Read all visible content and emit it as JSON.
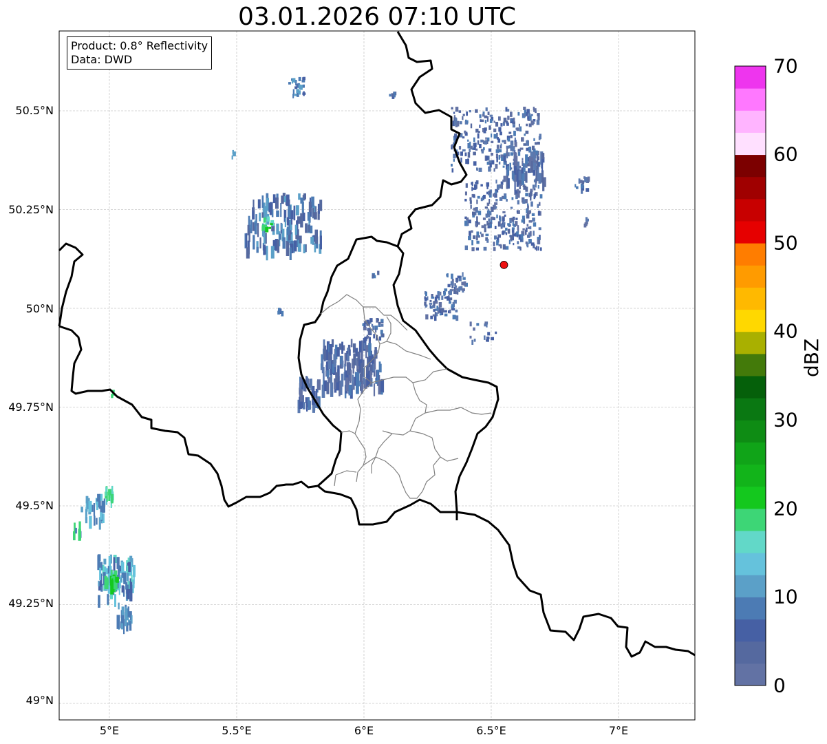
{
  "title": "03.01.2026 07:10 UTC",
  "infobox": {
    "product": "Product: 0.8° Reflectivity",
    "data": "Data: DWD"
  },
  "axes": {
    "lon_ticks": [
      "5°E",
      "5.5°E",
      "6°E",
      "6.5°E",
      "7°E"
    ],
    "lat_ticks": [
      "50.5°N",
      "50.25°N",
      "50°N",
      "49.75°N",
      "49.5°N",
      "49.25°N",
      "49°N"
    ],
    "lon_range": [
      4.8,
      7.3
    ],
    "lat_range": [
      48.95,
      50.7
    ]
  },
  "colorbar": {
    "label": "dBZ",
    "ticks": [
      "0",
      "10",
      "20",
      "30",
      "40",
      "50",
      "60",
      "70"
    ],
    "range": [
      0,
      70
    ],
    "colors": [
      "#6272a4",
      "#55699f",
      "#4660a4",
      "#4c7bb4",
      "#5ba0c8",
      "#65c2dc",
      "#62d8c8",
      "#3dd676",
      "#14c81e",
      "#12b41a",
      "#10a418",
      "#0e8c14",
      "#0a7812",
      "#05600a",
      "#437a0a",
      "#a9b000",
      "#ffd800",
      "#ffb900",
      "#ff9b00",
      "#ff7d00",
      "#e60000",
      "#c80000",
      "#a00000",
      "#7c0000",
      "#ffe0ff",
      "#ffb4ff",
      "#ff78ff",
      "#ee35ee"
    ]
  },
  "site_marker": {
    "lon": 6.55,
    "lat": 50.11,
    "color": "#ee1111"
  },
  "colors": {
    "border": "#000000",
    "admin": "#808080",
    "grid": "#c8c8c8"
  }
}
